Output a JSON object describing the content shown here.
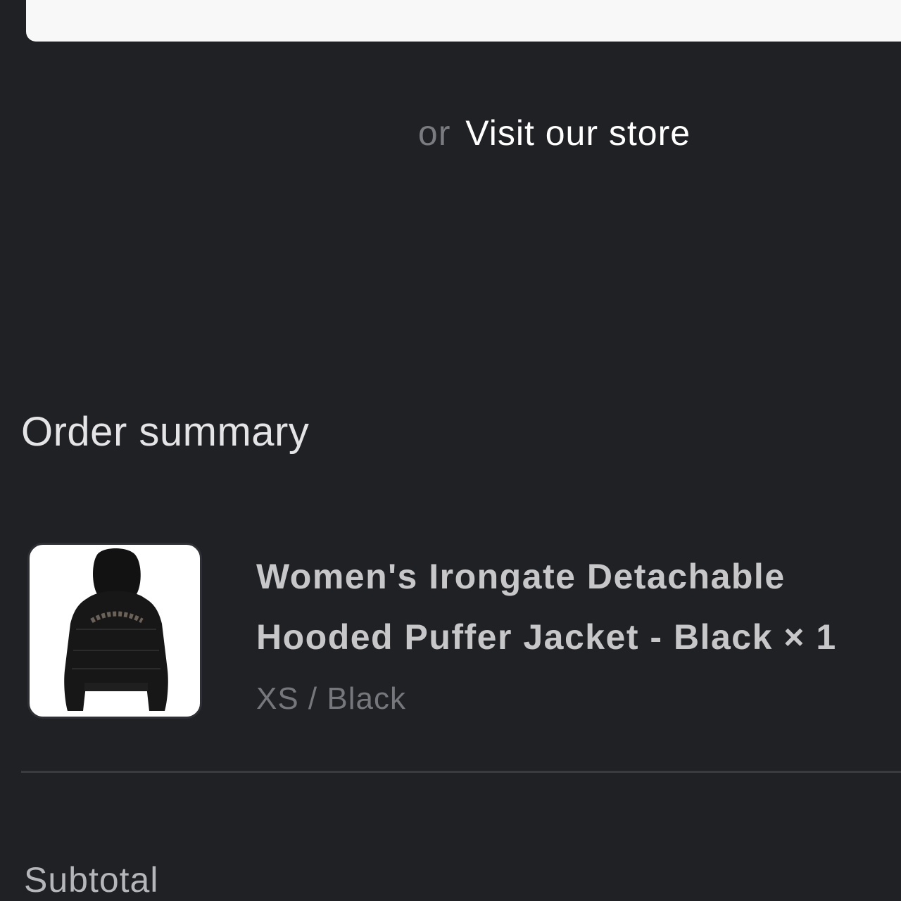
{
  "alternative": {
    "or_label": "or",
    "visit_store_label": "Visit our store"
  },
  "order_summary": {
    "title": "Order summary",
    "items": [
      {
        "name": "Women's Irongate Detachable Hooded Puffer Jacket - Black × 1",
        "variant": "XS / Black",
        "image_icon": "black-puffer-jacket-image"
      }
    ],
    "subtotal_label": "Subtotal"
  },
  "colors": {
    "background": "#202125",
    "button_background": "#f8f8f8",
    "text_primary": "#ffffff",
    "text_muted": "#7a7b80"
  }
}
